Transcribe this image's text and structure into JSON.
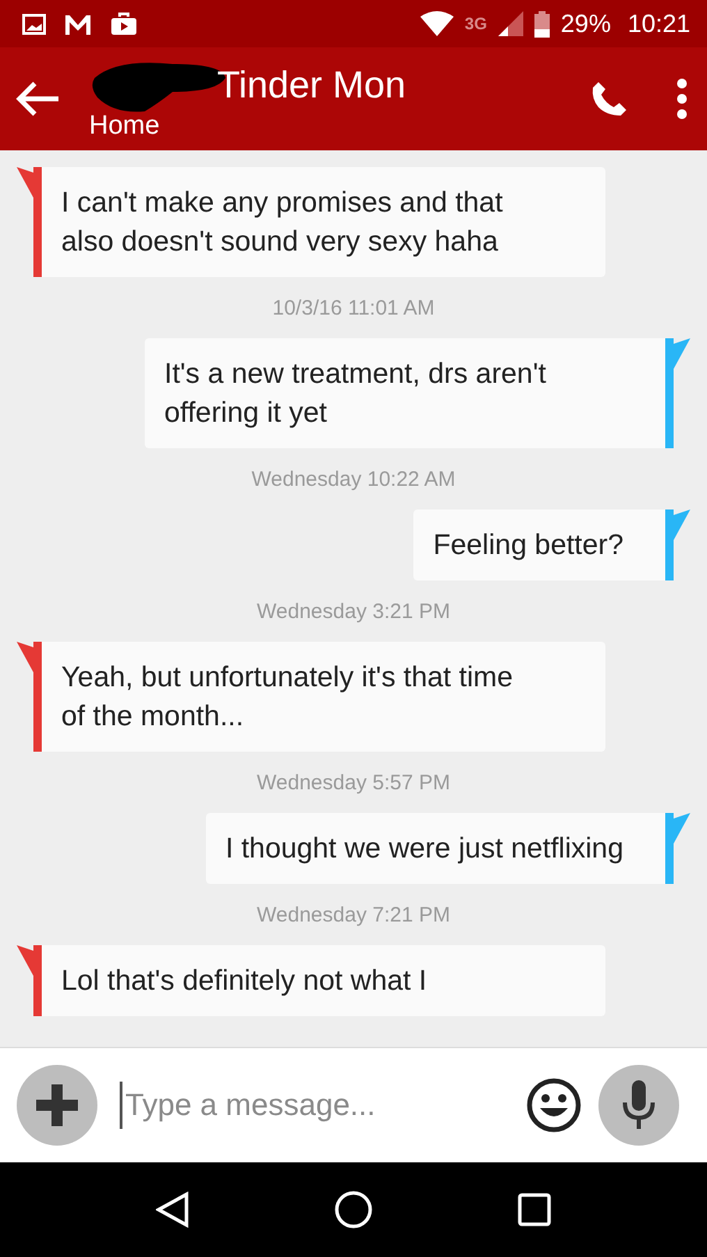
{
  "status_bar": {
    "network": "3G",
    "battery": "29%",
    "time": "10:21"
  },
  "header": {
    "title": "Tinder Mon",
    "subtitle": "Home"
  },
  "thread": [
    {
      "kind": "incoming",
      "text": "I can't make any promises and that also doesn't sound very sexy haha"
    },
    {
      "kind": "timestamp",
      "text": "10/3/16 11:01 AM"
    },
    {
      "kind": "outgoing",
      "text": "It's a new treatment, drs aren't offering it yet"
    },
    {
      "kind": "timestamp",
      "text": "Wednesday 10:22 AM"
    },
    {
      "kind": "outgoing",
      "text": "Feeling better?"
    },
    {
      "kind": "timestamp",
      "text": "Wednesday 3:21 PM"
    },
    {
      "kind": "incoming",
      "text": "Yeah, but unfortunately it's that time of the month..."
    },
    {
      "kind": "timestamp",
      "text": "Wednesday 5:57 PM"
    },
    {
      "kind": "outgoing",
      "text": "I thought we were just netflixing"
    },
    {
      "kind": "timestamp",
      "text": "Wednesday 7:21 PM"
    },
    {
      "kind": "incoming",
      "text": "Lol that's definitely not what I"
    }
  ],
  "composer": {
    "placeholder": "Type a message..."
  }
}
